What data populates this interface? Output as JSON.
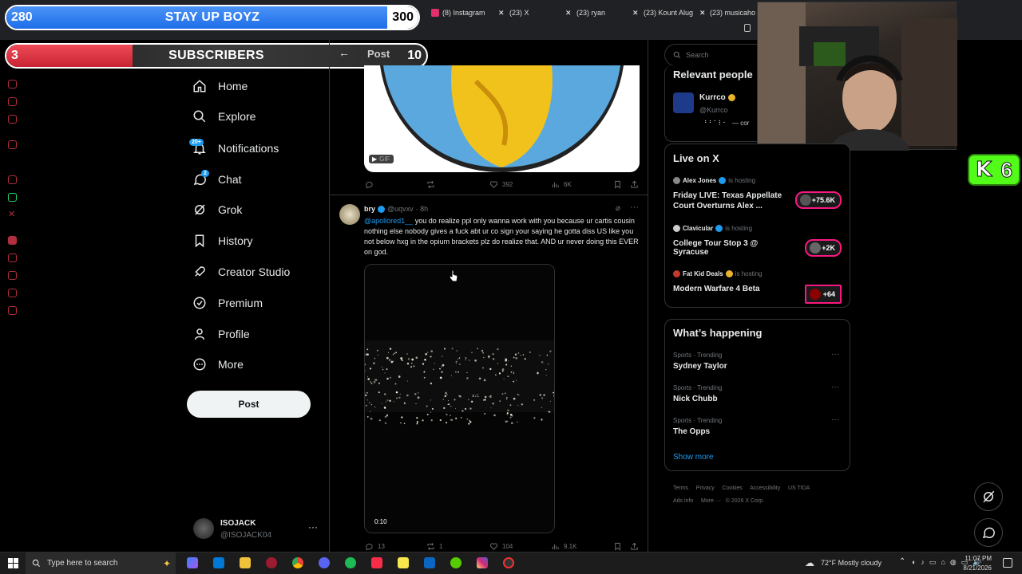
{
  "overlay": {
    "bar1": {
      "left_value": "280",
      "title": "STAY UP BOYZ",
      "right_value": "300",
      "progress": 0.933
    },
    "bar2": {
      "left_value": "3",
      "title": "SUBSCRIBERS",
      "right_value": "10",
      "progress": 0.3
    },
    "kick_badge": "6"
  },
  "browser_tabs": [
    {
      "label": "(8) Instagram",
      "color": "#e1306c"
    },
    {
      "label": "(23) X",
      "color": "#ffffff"
    },
    {
      "label": "(23) ryan",
      "color": "#ffffff"
    },
    {
      "label": "(23) Kount Alug",
      "color": "#ffffff"
    },
    {
      "label": "(23) musicaho",
      "color": "#ffffff"
    }
  ],
  "nav": {
    "items": [
      "Home",
      "Explore",
      "Notifications",
      "Chat",
      "Grok",
      "History",
      "Creator Studio",
      "Premium",
      "Profile",
      "More"
    ],
    "notifications_badge": "20+",
    "chat_badge": "2",
    "post_button": "Post"
  },
  "header": {
    "title": "Post"
  },
  "account": {
    "name": "ISOJACK",
    "handle": "@ISOJACK04"
  },
  "gif_post": {
    "gif_label": "GIF",
    "likes": "392",
    "views": "6K"
  },
  "tweet": {
    "name": "bry",
    "handle": "@uqvxv",
    "time": "· 8h",
    "mention": "@apollored1__",
    "text": " you do realize ppl only wanna work with you because ur cartis cousin nothing else nobody gives a fuck abt ur co sign your saying he gotta diss US like you not below hxg in the opium brackets plz do realize that. AND ur never doing this EVER on god.",
    "video_time": "0:10",
    "replies": "13",
    "reposts": "1",
    "likes": "104",
    "views": "9.1K"
  },
  "search": {
    "placeholder": "Search"
  },
  "relevant": {
    "title": "Relevant people",
    "name": "Kurrco",
    "handle": "@Kurrco",
    "bio": "⠀⠃⠃⠁⠇⠂⠀— cor"
  },
  "live": {
    "title": "Live on X",
    "items": [
      {
        "host": "Alex Jones",
        "hosting": "is hosting",
        "title": "Friday LIVE: Texas Appellate Court Overturns Alex ...",
        "count": "+75.6K"
      },
      {
        "host": "Clavicular",
        "hosting": "is hosting",
        "title": "College Tour Stop 3 @ Syracuse",
        "count": "+2K"
      },
      {
        "host": "Fat Kid Deals",
        "hosting": "is hosting",
        "title": "Modern Warfare 4 Beta",
        "count": "+64"
      }
    ]
  },
  "happening": {
    "title": "What’s happening",
    "items": [
      {
        "category": "Sports · Trending",
        "topic": "Sydney Taylor"
      },
      {
        "category": "Sports · Trending",
        "topic": "Nick Chubb"
      },
      {
        "category": "Sports · Trending",
        "topic": "The Opps"
      }
    ],
    "show_more": "Show more"
  },
  "footer": {
    "links": [
      "Terms",
      "Privacy",
      "Cookies",
      "Accessibility",
      "US TIDA",
      "Ads info",
      "More ···",
      "© 2026 X Corp."
    ]
  },
  "taskbar": {
    "search_placeholder": "Type here to search",
    "weather": "72°F  Mostly cloudy",
    "time": "11:07 PM",
    "date": "8/21/2026"
  },
  "colors": {
    "accent": "#1d9bf0",
    "bar_blue": "#2a7ff0",
    "bar_red": "#e53845",
    "kick_green": "#53fc18"
  }
}
